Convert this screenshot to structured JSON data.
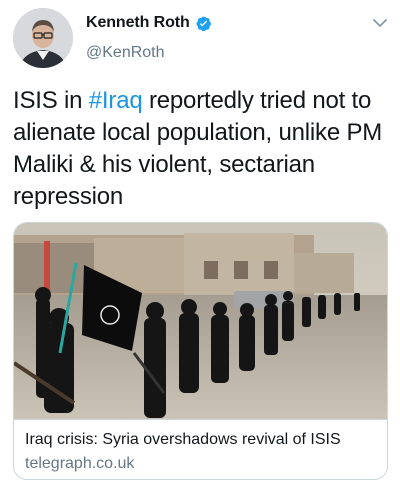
{
  "tweet": {
    "author_name": "Kenneth Roth",
    "handle": "@KenRoth",
    "verified": true,
    "text_before": "ISIS in ",
    "hashtag": "#Iraq",
    "text_after": " reportedly tried not to alienate local population, unlike PM Maliki & his violent, sectarian repression"
  },
  "card": {
    "title": "Iraq crisis: Syria overshadows revival of ISIS",
    "domain": "telegraph.co.uk"
  },
  "icons": {
    "verified": "verified-badge-icon",
    "caret": "chevron-down-icon"
  },
  "colors": {
    "link": "#1b95e0",
    "secondary_text": "#657786",
    "border": "#ccd6dd"
  }
}
